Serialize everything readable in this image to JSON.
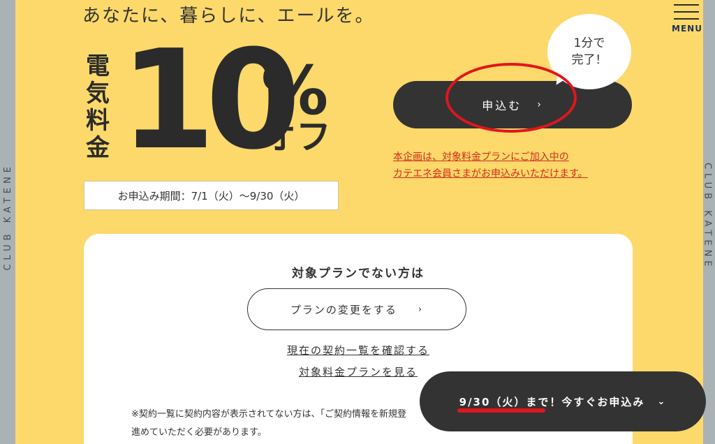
{
  "side": {
    "left_label": "CLUB KATENE",
    "right_label": "CLUB KATENE"
  },
  "header": {
    "tagline": "あなたに、暮らしに、エールを。",
    "menu_label": "MENU"
  },
  "hero": {
    "vertical_kanji": [
      "電",
      "気",
      "料",
      "金"
    ],
    "big_number": "10",
    "percent": "%",
    "off": "オフ",
    "period": "お申込み期間：7/1（火）〜9/30（火）"
  },
  "apply": {
    "button_label": "申込む",
    "chevron": "›",
    "bubble_line1": "1分で",
    "bubble_line2": "完了！",
    "notice_line1": "本企画は、対象料金プランにご加入中の",
    "notice_line2": "カテエネ会員さまがお申込みいただけます。"
  },
  "card": {
    "title": "対象プランでない方は",
    "plan_button_label": "プランの変更をする",
    "plan_chevron": "›",
    "link_contracts": "現在の契約一覧を確認する",
    "link_plans": "対象料金プランを見る",
    "note_line1": "※契約一覧に契約内容が表示されてない方は、「ご契約情報を新規登",
    "note_line2": "進めていただく必要があります。"
  },
  "floating_cta": {
    "label": "9/30（火）まで！今すぐお申込み",
    "chevron": "⌄"
  },
  "colors": {
    "background": "#fcd96a",
    "dark": "#333333",
    "accent_red": "#e0161d",
    "notice_red": "#d42a1a"
  }
}
